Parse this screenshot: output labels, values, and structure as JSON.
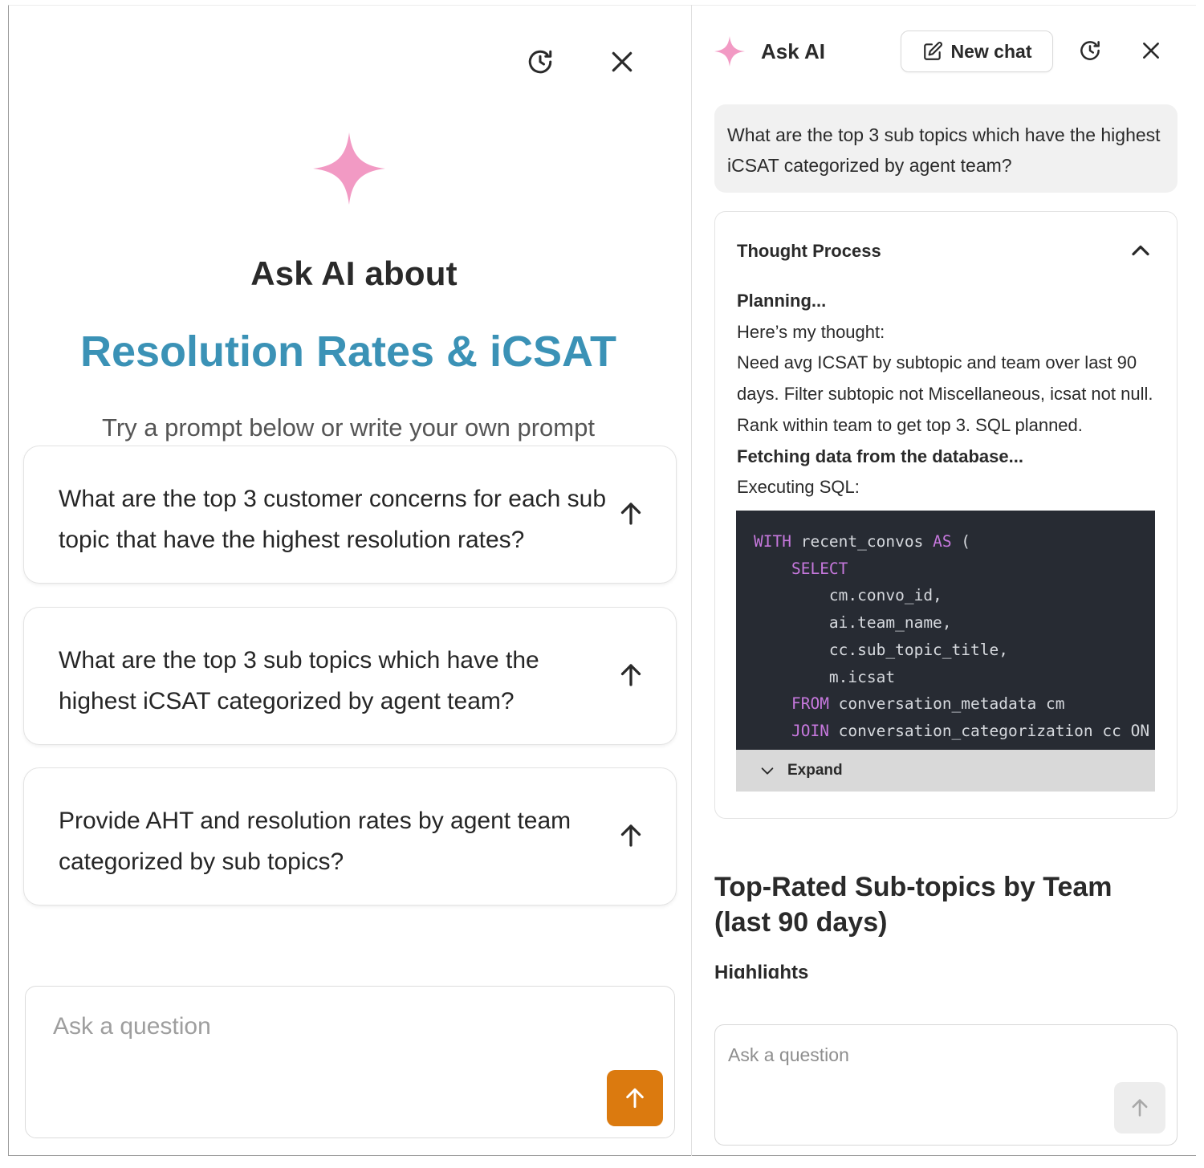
{
  "left_panel": {
    "hero": {
      "title": "Ask AI about",
      "topic": "Resolution Rates & iCSAT",
      "subtitle": "Try a prompt below or write your own prompt"
    },
    "prompts": [
      {
        "text": "What are the top 3 customer concerns for each sub topic that have the highest resolution rates?"
      },
      {
        "text": "What are the top 3 sub topics which have the highest iCSAT categorized by agent team?"
      },
      {
        "text": "Provide AHT and resolution rates by agent team categorized by sub topics?"
      }
    ],
    "input": {
      "placeholder": "Ask a question"
    }
  },
  "right_panel": {
    "header": {
      "title": "Ask AI",
      "new_chat_label": "New chat"
    },
    "user_message": "What are the top 3 sub topics which have the highest iCSAT categorized by agent team?",
    "thought_process": {
      "heading": "Thought Process",
      "planning": "Planning...",
      "intro": "Here’s my thought:",
      "thought": "Need avg ICSAT by subtopic and team over last 90 days. Filter subtopic not Miscellaneous, icsat not null. Rank within team to get top 3. SQL planned.",
      "fetching": "Fetching data from the database...",
      "executing": "Executing SQL:",
      "sql_lines": [
        {
          "kw": "WITH",
          "rest": " recent_convos ",
          "kw2": "AS",
          "rest2": " ("
        },
        {
          "indent": "    ",
          "kw": "SELECT",
          "rest": ""
        },
        {
          "indent": "        ",
          "kw": "",
          "rest": "cm.convo_id,"
        },
        {
          "indent": "        ",
          "kw": "",
          "rest": "ai.team_name,"
        },
        {
          "indent": "        ",
          "kw": "",
          "rest": "cc.sub_topic_title,"
        },
        {
          "indent": "        ",
          "kw": "",
          "rest": "m.icsat"
        },
        {
          "indent": "    ",
          "kw": "FROM",
          "rest": " conversation_metadata cm"
        },
        {
          "indent": "    ",
          "kw": "JOIN",
          "rest": " conversation_categorization cc ON"
        }
      ],
      "expand_label": "Expand"
    },
    "result_title": "Top-Rated Sub-topics by Team (last 90 days)",
    "highlights_label": "Highlights",
    "input": {
      "placeholder": "Ask a question"
    }
  },
  "colors": {
    "accent_star": "#f29ac4",
    "topic_blue": "#3b92b6",
    "send_orange": "#db7a0f",
    "code_bg": "#272b33",
    "code_keyword": "#c678dd"
  },
  "icons": [
    "history-icon",
    "close-icon",
    "sparkle-icon",
    "arrow-up-icon",
    "edit-icon",
    "chevron-up-icon",
    "chevron-down-icon"
  ]
}
